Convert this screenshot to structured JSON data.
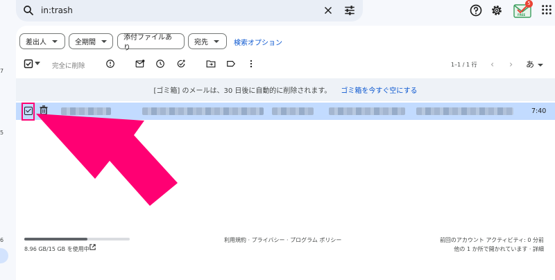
{
  "left_rail": {
    "numbers": [
      "7",
      "5",
      "6"
    ]
  },
  "search": {
    "query": "in:trash"
  },
  "app": {
    "badge_count": "5",
    "logo_label": "FREE"
  },
  "filters": [
    {
      "label": "差出人"
    },
    {
      "label": "全期間"
    },
    {
      "label": "添付ファイルあり"
    },
    {
      "label": "宛先"
    }
  ],
  "search_options": "検索オプション",
  "toolbar": {
    "delete_forever": "完全に削除",
    "page_range": "1–1 / 1 行",
    "input_tool": "あ"
  },
  "notice": {
    "text": "[ゴミ箱] のメールは、30 日後に自動的に削除されます。",
    "link": "ゴミ箱を今すぐ空にする"
  },
  "mail_row": {
    "time": "7:40"
  },
  "footer": {
    "storage": "8.96 GB/15 GB を使用中",
    "storage_fraction": 0.6,
    "links": "利用規約 · プライバシー · プログラム ポリシー",
    "last_activity": "前回のアカウント アクティビティ: 0 分前",
    "other_locations": "他の 1 か所で開かれています · 詳細"
  },
  "colors": {
    "highlight": "#ff0073",
    "selected_row": "#c2dbff",
    "link": "#0b57d0"
  }
}
